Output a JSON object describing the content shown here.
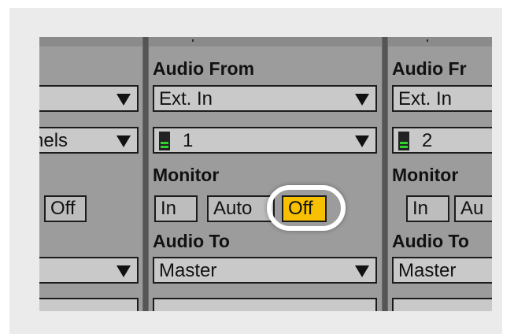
{
  "colors": {
    "panel_bg": "#9c9c9c",
    "field_bg": "#c9c9c9",
    "active_button": "#f7c000",
    "meter_green": "#2fd12f",
    "highlight_ring": "#ffffff"
  },
  "left_track": {
    "dropdown1_text": "",
    "dropdown2_text": "nels",
    "monitor_off": "Off",
    "audio_to_value": ""
  },
  "middle_track": {
    "audio_from_label": "Audio From",
    "input_type": "Ext. In",
    "input_channel": "1",
    "monitor_label": "Monitor",
    "monitor_buttons": [
      "In",
      "Auto",
      "Off"
    ],
    "active_monitor": "Off",
    "audio_to_label": "Audio To",
    "audio_to_value": "Master"
  },
  "right_track": {
    "audio_from_label": "Audio Fr",
    "input_type": "Ext. In",
    "input_channel": "2",
    "monitor_label": "Monitor",
    "monitor_buttons": [
      "In",
      "Au"
    ],
    "audio_to_label": "Audio To",
    "audio_to_value": "Master"
  },
  "icons": [
    "dropdown-arrow-icon",
    "level-meter-icon",
    "highlight-circle"
  ]
}
